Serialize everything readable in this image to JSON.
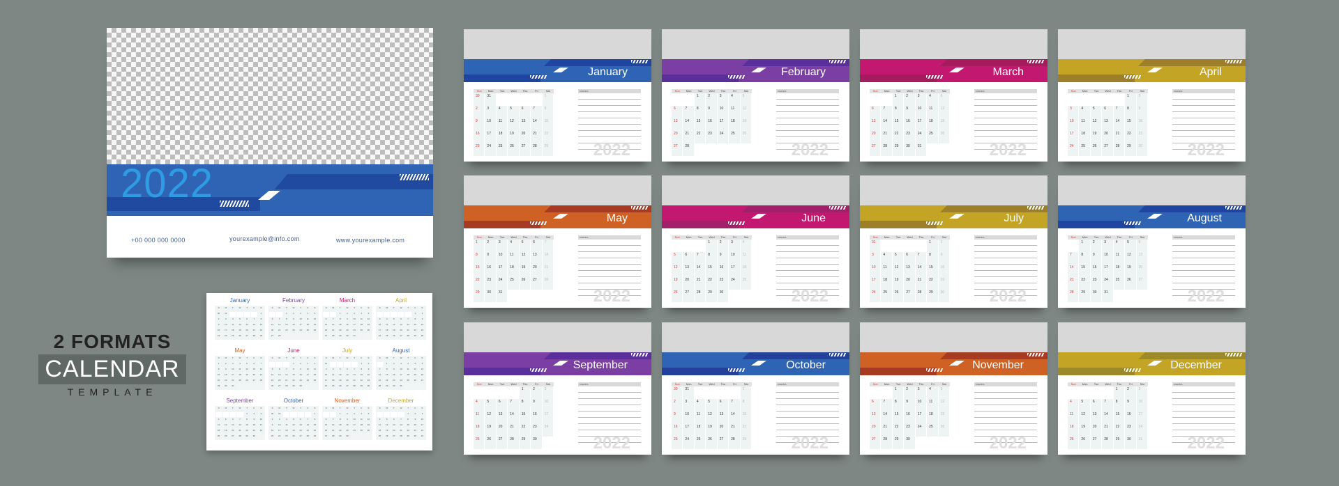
{
  "cover": {
    "year": "2022",
    "phone": "+00 000 000 0000",
    "email": "yourexample@info.com",
    "website": "www.yourexample.com",
    "band_color": "#2f63b3",
    "year_color": "#2f9be3"
  },
  "promo": {
    "line1": "2 FORMATS",
    "line2": "CALENDAR",
    "line3": "TEMPLATE"
  },
  "weekdays": [
    "Sun",
    "Mon",
    "Tue",
    "Wed",
    "Thu",
    "Fri",
    "Sat"
  ],
  "agenda_label": "AGENDA",
  "year": "2022",
  "months": [
    {
      "name": "January",
      "color": "#2f63b3",
      "dark": "#1f45a0",
      "cells": [
        30,
        31,
        "",
        "",
        "",
        "",
        1,
        2,
        3,
        4,
        5,
        6,
        7,
        8,
        9,
        10,
        11,
        12,
        13,
        14,
        15,
        16,
        17,
        18,
        19,
        20,
        21,
        22,
        23,
        24,
        25,
        26,
        27,
        28,
        29
      ]
    },
    {
      "name": "February",
      "color": "#7b3fa3",
      "dark": "#5a2f9b",
      "cells": [
        "",
        "",
        1,
        2,
        3,
        4,
        5,
        6,
        7,
        8,
        9,
        10,
        11,
        12,
        13,
        14,
        15,
        16,
        17,
        18,
        19,
        20,
        21,
        22,
        23,
        24,
        25,
        26,
        27,
        28
      ]
    },
    {
      "name": "March",
      "color": "#c2186f",
      "dark": "#a61a5e",
      "cells": [
        "",
        "",
        1,
        2,
        3,
        4,
        5,
        6,
        7,
        8,
        9,
        10,
        11,
        12,
        13,
        14,
        15,
        16,
        17,
        18,
        19,
        20,
        21,
        22,
        23,
        24,
        25,
        26,
        27,
        28,
        29,
        30,
        31
      ]
    },
    {
      "name": "April",
      "color": "#c3a425",
      "dark": "#9c7f28",
      "cells": [
        "",
        "",
        "",
        "",
        "",
        1,
        2,
        3,
        4,
        5,
        6,
        7,
        8,
        9,
        10,
        11,
        12,
        13,
        14,
        15,
        16,
        17,
        18,
        19,
        20,
        21,
        22,
        23,
        24,
        25,
        26,
        27,
        28,
        29,
        30
      ]
    },
    {
      "name": "May",
      "color": "#cf6124",
      "dark": "#a63a22",
      "cells": [
        1,
        2,
        3,
        4,
        5,
        6,
        7,
        8,
        9,
        10,
        11,
        12,
        13,
        14,
        15,
        16,
        17,
        18,
        19,
        20,
        21,
        22,
        23,
        24,
        25,
        26,
        27,
        28,
        29,
        30,
        31
      ]
    },
    {
      "name": "June",
      "color": "#c2186f",
      "dark": "#a2206a",
      "cells": [
        "",
        "",
        "",
        1,
        2,
        3,
        4,
        5,
        6,
        7,
        8,
        9,
        10,
        11,
        12,
        13,
        14,
        15,
        16,
        17,
        18,
        19,
        20,
        21,
        22,
        23,
        24,
        25,
        26,
        27,
        28,
        29,
        30
      ]
    },
    {
      "name": "July",
      "color": "#c3a425",
      "dark": "#9c7f28",
      "cells": [
        31,
        "",
        "",
        "",
        "",
        1,
        2,
        3,
        4,
        5,
        6,
        7,
        8,
        9,
        10,
        11,
        12,
        13,
        14,
        15,
        16,
        17,
        18,
        19,
        20,
        21,
        22,
        23,
        24,
        25,
        26,
        27,
        28,
        29,
        30
      ]
    },
    {
      "name": "August",
      "color": "#2f63b3",
      "dark": "#1f45a0",
      "cells": [
        "",
        1,
        2,
        3,
        4,
        5,
        6,
        7,
        8,
        9,
        10,
        11,
        12,
        13,
        14,
        15,
        16,
        17,
        18,
        19,
        20,
        21,
        22,
        23,
        24,
        25,
        26,
        27,
        28,
        29,
        30,
        31
      ]
    },
    {
      "name": "September",
      "color": "#7b3fa3",
      "dark": "#5a2f9b",
      "cells": [
        "",
        "",
        "",
        "",
        1,
        2,
        3,
        4,
        5,
        6,
        7,
        8,
        9,
        10,
        11,
        12,
        13,
        14,
        15,
        16,
        17,
        18,
        19,
        20,
        21,
        22,
        23,
        24,
        25,
        26,
        27,
        28,
        29,
        30
      ]
    },
    {
      "name": "October",
      "color": "#2f63b3",
      "dark": "#23409a",
      "cells": [
        30,
        31,
        "",
        "",
        "",
        "",
        1,
        2,
        3,
        4,
        5,
        6,
        7,
        8,
        9,
        10,
        11,
        12,
        13,
        14,
        15,
        16,
        17,
        18,
        19,
        20,
        21,
        22,
        23,
        24,
        25,
        26,
        27,
        28,
        29
      ]
    },
    {
      "name": "November",
      "color": "#cf6124",
      "dark": "#a63a22",
      "cells": [
        "",
        "",
        1,
        2,
        3,
        4,
        5,
        6,
        7,
        8,
        9,
        10,
        11,
        12,
        13,
        14,
        15,
        16,
        17,
        18,
        19,
        20,
        21,
        22,
        23,
        24,
        25,
        26,
        27,
        28,
        29,
        30
      ]
    },
    {
      "name": "December",
      "color": "#c3a425",
      "dark": "#9c8a2a",
      "cells": [
        "",
        "",
        "",
        "",
        1,
        2,
        3,
        4,
        5,
        6,
        7,
        8,
        9,
        10,
        11,
        12,
        13,
        14,
        15,
        16,
        17,
        18,
        19,
        20,
        21,
        22,
        23,
        24,
        25,
        26,
        27,
        28,
        29,
        30,
        31
      ]
    }
  ]
}
